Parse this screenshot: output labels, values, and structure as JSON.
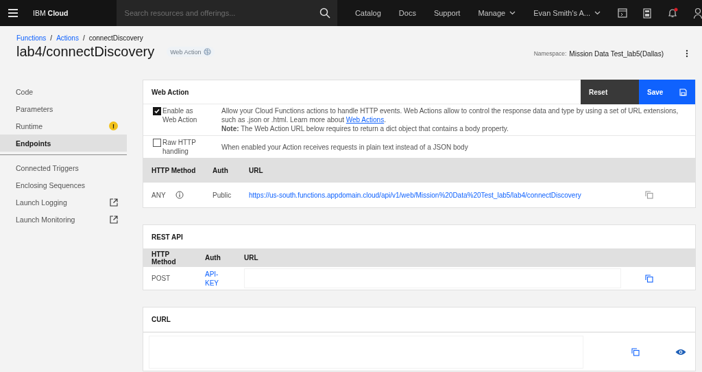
{
  "topbar": {
    "brand_plain": "IBM",
    "brand_bold": "Cloud",
    "search": {
      "placeholder": "Search resources and offerings..."
    },
    "links": [
      {
        "label": "Catalog",
        "dropdown": false
      },
      {
        "label": "Docs",
        "dropdown": false
      },
      {
        "label": "Support",
        "dropdown": false
      },
      {
        "label": "Manage",
        "dropdown": true
      },
      {
        "label": "Evan Smith's A...",
        "dropdown": true
      }
    ],
    "notification_dot": true
  },
  "breadcrumb": [
    {
      "label": "Functions",
      "link": true
    },
    {
      "label": "Actions",
      "link": true
    },
    {
      "label": "connectDiscovery",
      "link": false
    }
  ],
  "breadcrumb_separator": "/",
  "title": "lab4/connectDiscovery",
  "tag": "Web Action",
  "namespace": {
    "label": "Namespace:",
    "value": "Mission Data Test_lab5(Dallas)"
  },
  "sidebar": {
    "items": [
      {
        "label": "Code",
        "kind": "plain",
        "selected": false
      },
      {
        "label": "Parameters",
        "kind": "plain",
        "selected": false
      },
      {
        "label": "Runtime",
        "kind": "warning",
        "selected": false,
        "badge": "!"
      },
      {
        "label": "Endpoints",
        "kind": "plain",
        "selected": true
      },
      {
        "label": "Connected Triggers",
        "kind": "plain",
        "selected": false,
        "divider_before": true
      },
      {
        "label": "Enclosing Sequences",
        "kind": "plain",
        "selected": false
      },
      {
        "label": "Launch Logging",
        "kind": "external",
        "selected": false
      },
      {
        "label": "Launch Monitoring",
        "kind": "external",
        "selected": false
      }
    ]
  },
  "web_action": {
    "title": "Web Action",
    "reset": "Reset",
    "save": "Save",
    "options": [
      {
        "label": "Enable as Web Action",
        "checked": true,
        "text": "Allow your Cloud Functions actions to handle HTTP events. Web Actions allow to control the response data and type by using a set of URL extensions, such as .json or .html. Learn more about ",
        "link": "Web Actions",
        "after": ".",
        "note": "**Note:** The Web Action URL below requires to return a dict object that contains a body property."
      },
      {
        "label": "Raw HTTP handling",
        "checked": false,
        "text": "When enabled your Action receives requests in plain text instead of a JSON body"
      }
    ],
    "columns": [
      "HTTP Method",
      "Auth",
      "URL"
    ],
    "row": {
      "method": "ANY",
      "auth": "Public",
      "url": "https://us-south.functions.appdomain.cloud/api/v1/web/Mission%20Data%20Test_lab5/lab4/connectDiscovery"
    }
  },
  "rest_api": {
    "title": "REST API",
    "columns": [
      "HTTP Method",
      "Auth",
      "URL"
    ],
    "row": {
      "method": "POST",
      "auth": "API-KEY"
    }
  },
  "curl": {
    "title": "CURL"
  }
}
